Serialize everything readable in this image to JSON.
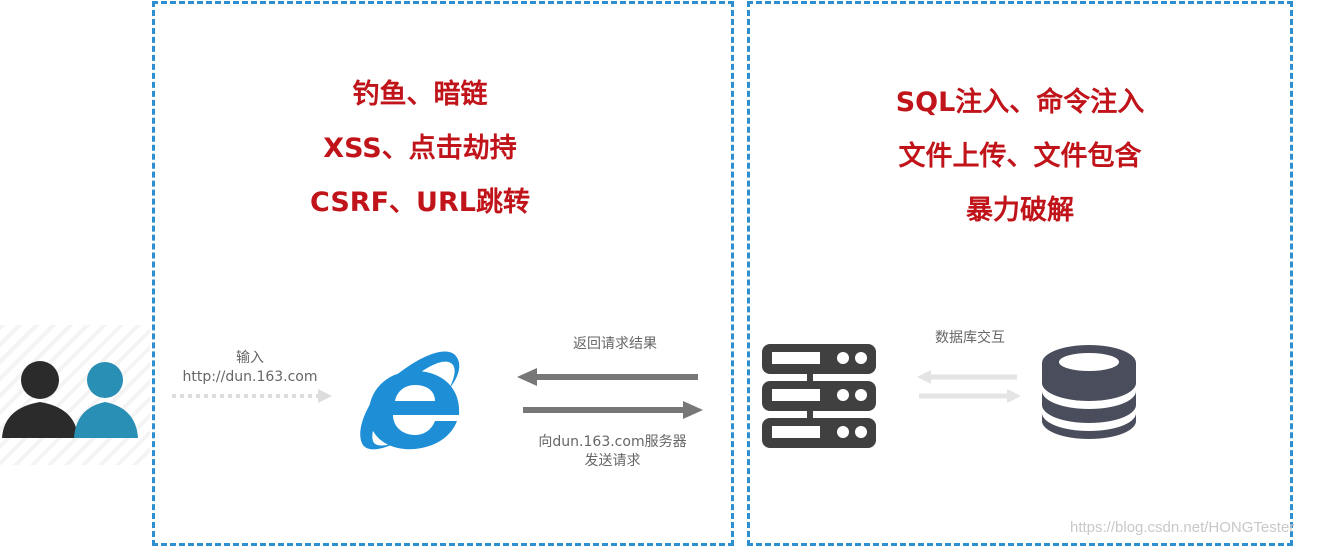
{
  "client_box": {
    "attacks": [
      "钓鱼、暗链",
      "XSS、点击劫持",
      "CSRF、URL跳转"
    ],
    "input_label": "输入",
    "input_url": "http://dun.163.com",
    "response_label": "返回请求结果",
    "request_label_1": "向dun.163.com服务器",
    "request_label_2": "发送请求"
  },
  "server_box": {
    "attacks": [
      "SQL注入、命令注入",
      "文件上传、文件包含",
      "暴力破解"
    ],
    "db_label": "数据库交互"
  },
  "watermark": "https://blog.csdn.net/HONGTester",
  "colors": {
    "border": "#2e8fd0",
    "attack_text": "#c0141a",
    "ie_blue": "#1e8fd6",
    "server": "#404040",
    "db": "#4a4e5c"
  }
}
